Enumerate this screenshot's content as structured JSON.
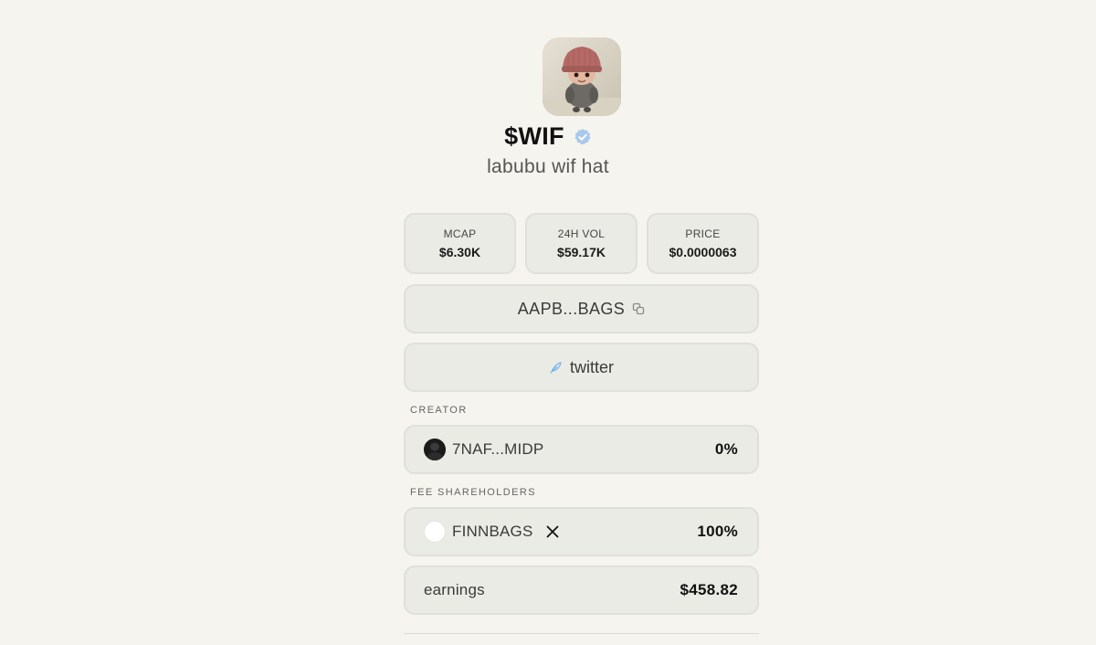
{
  "token": {
    "image_icon": "labubu-wif-hat-image",
    "ticker": "$WIF",
    "name": "labubu wif hat",
    "verified_icon": "verified-badge-icon"
  },
  "stats": [
    {
      "label": "MCAP",
      "value": "$6.30K"
    },
    {
      "label": "24H VOL",
      "value": "$59.17K"
    },
    {
      "label": "PRICE",
      "value": "$0.0000063"
    }
  ],
  "contract": {
    "address": "AAPB...BAGS",
    "copy_icon": "copy-icon"
  },
  "social": {
    "label": "twitter",
    "icon": "feather-icon"
  },
  "creator": {
    "section_label": "CREATOR",
    "address": "7NAF...MIDP",
    "share": "0%"
  },
  "fee_shareholders": {
    "section_label": "FEE SHAREHOLDERS",
    "items": [
      {
        "name": "FINNBAGS",
        "share": "100%",
        "icon": "x-logo-icon"
      }
    ]
  },
  "earnings": {
    "label": "earnings",
    "value": "$458.82"
  },
  "colors": {
    "background": "#f5f4ee",
    "card": "#ebebe6",
    "card_border": "#e0e0da",
    "verified": "#9cc2e8"
  }
}
